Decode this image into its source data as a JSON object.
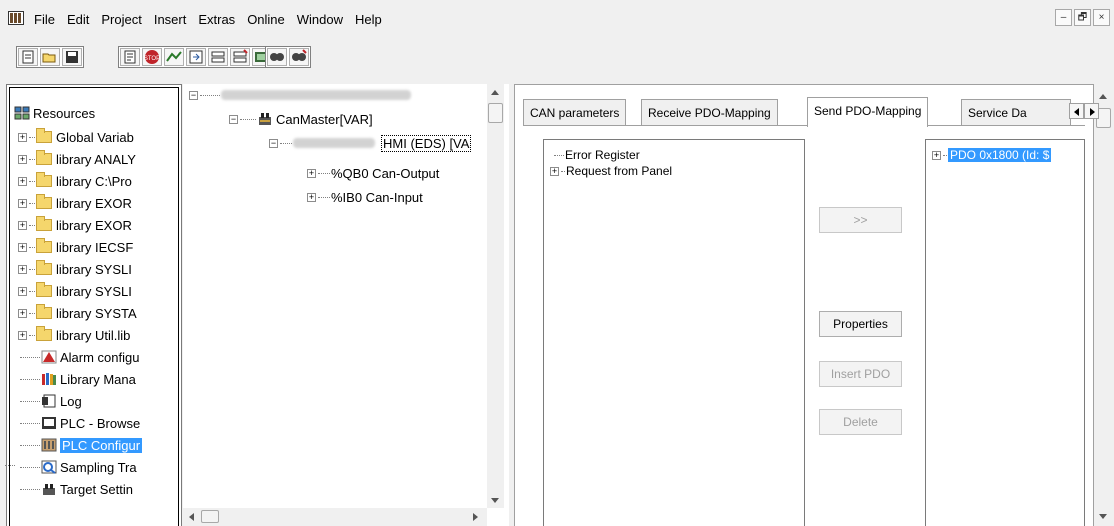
{
  "menubar": {
    "items": [
      "File",
      "Edit",
      "Project",
      "Insert",
      "Extras",
      "Online",
      "Window",
      "Help"
    ],
    "window_buttons": [
      "–",
      "🗗",
      "×"
    ]
  },
  "toolbar": {
    "groups": [
      [
        "new-icon",
        "open-icon",
        "save-icon"
      ],
      [
        "compile-icon",
        "stop-icon",
        "login-icon",
        "logout-icon",
        "monitor-icon",
        "display-icon",
        "project-icon"
      ],
      [
        "find-icon",
        "replace-icon"
      ]
    ]
  },
  "resources": {
    "title": "Resources",
    "items": [
      {
        "label": "Global Variab",
        "type": "folder"
      },
      {
        "label": "library ANALY",
        "type": "folder"
      },
      {
        "label": "library C:\\Pro",
        "type": "folder"
      },
      {
        "label": "library EXOR",
        "type": "folder"
      },
      {
        "label": "library EXOR",
        "type": "folder"
      },
      {
        "label": "library IECSF",
        "type": "folder"
      },
      {
        "label": "library SYSLI",
        "type": "folder"
      },
      {
        "label": "library SYSLI",
        "type": "folder"
      },
      {
        "label": "library SYSTA",
        "type": "folder"
      },
      {
        "label": "library Util.lib",
        "type": "folder"
      },
      {
        "label": "Alarm configu",
        "type": "alarm"
      },
      {
        "label": "Library Mana",
        "type": "library"
      },
      {
        "label": "Log",
        "type": "log"
      },
      {
        "label": "PLC - Browse",
        "type": "browse"
      },
      {
        "label": "PLC Configur",
        "type": "config",
        "selected": true
      },
      {
        "label": "Sampling Tra",
        "type": "sampling"
      },
      {
        "label": "Target Settin",
        "type": "target"
      }
    ]
  },
  "plc_tree": {
    "can_master": "CanMaster[VAR]",
    "hmi_node": "HMI (EDS)  [VA",
    "outputs": "%QB0 Can-Output",
    "inputs": "%IB0 Can-Input"
  },
  "tabs": [
    {
      "label": "CAN parameters",
      "active": false
    },
    {
      "label": "Receive PDO-Mapping",
      "active": false
    },
    {
      "label": "Send PDO-Mapping",
      "active": true
    },
    {
      "label": "Service Da",
      "active": false
    }
  ],
  "object_list": [
    "Error Register",
    "Request from Panel"
  ],
  "pdo_list": [
    "PDO 0x1800 (Id: $"
  ],
  "buttons": {
    "add": ">>",
    "properties": "Properties",
    "insert_pdo": "Insert PDO",
    "delete": "Delete"
  },
  "colors": {
    "selection": "#3399ff",
    "background": "#f0f0f0",
    "disabled_text": "#a0a0a0"
  }
}
